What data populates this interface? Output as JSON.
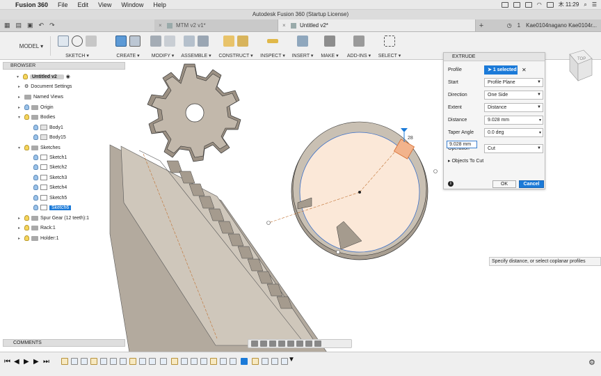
{
  "menubar": {
    "app": "Fusion 360",
    "items": [
      "File",
      "Edit",
      "View",
      "Window",
      "Help"
    ],
    "clock": "木 11:29"
  },
  "window": {
    "title": "Autodesk Fusion 360 (Startup License)"
  },
  "tabs": [
    {
      "label": "MTM v2 v1*"
    },
    {
      "label": "Untitled v2*"
    }
  ],
  "account": {
    "count": "1",
    "user": "Kae0104nagano Kae0104r..."
  },
  "toolbar": {
    "workspace": "MODEL ▾",
    "groups": [
      "SKETCH ▾",
      "CREATE ▾",
      "MODIFY ▾",
      "ASSEMBLE ▾",
      "CONSTRUCT ▾",
      "INSPECT ▾",
      "INSERT ▾",
      "MAKE ▾",
      "ADD-INS ▾",
      "SELECT ▾"
    ]
  },
  "browser": {
    "title": "BROWSER",
    "root": "Untitled v2",
    "items": [
      "Document Settings",
      "Named Views",
      "Origin",
      "Bodies",
      "Body1",
      "Body15",
      "Sketches",
      "Sketch1",
      "Sketch2",
      "Sketch3",
      "Sketch4",
      "Sketch5",
      "Sketch6",
      "Spur Gear (12 teeth):1",
      "Rack:1",
      "Holder:1"
    ]
  },
  "extrude": {
    "title": "EXTRUDE",
    "rows": [
      {
        "label": "Profile",
        "value": "1 selected"
      },
      {
        "label": "Start",
        "value": "Profile Plane"
      },
      {
        "label": "Direction",
        "value": "One Side"
      },
      {
        "label": "Extent",
        "value": "Distance"
      },
      {
        "label": "Distance",
        "value": "9.028 mm"
      },
      {
        "label": "Taper Angle",
        "value": "0.0 deg"
      },
      {
        "label": "Operation",
        "value": "Cut"
      }
    ],
    "objects_to_cut": "Objects To Cut",
    "ok": "OK",
    "cancel": "Cancel"
  },
  "canvas": {
    "distance_input": "9.028 mm",
    "dim_label": "28",
    "tooltip": "Specify distance, or select coplanar profiles"
  },
  "viewcube": {
    "face": "TOP"
  },
  "comments": {
    "title": "COMMENTS"
  }
}
